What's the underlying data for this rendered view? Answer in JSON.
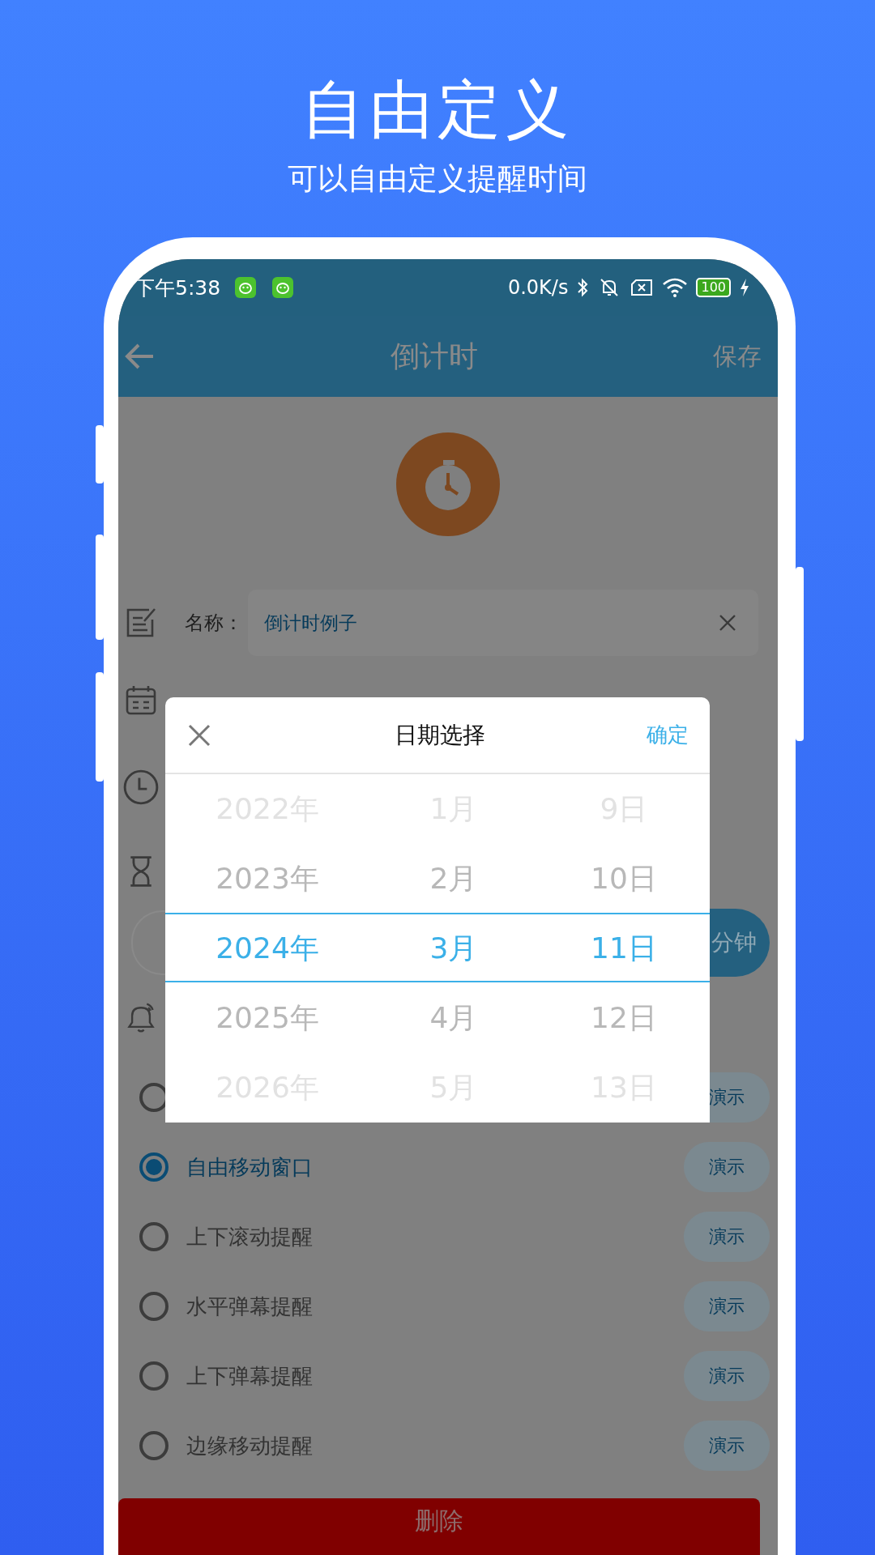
{
  "hero": {
    "title": "自由定义",
    "subtitle": "可以自由定义提醒时间"
  },
  "status_bar": {
    "time": "下午5:38",
    "net_speed": "0.0K/s",
    "battery": "100"
  },
  "header": {
    "title": "倒计时",
    "action": "保存"
  },
  "form": {
    "name_label": "名称：",
    "name_value": "倒计时例子",
    "duration_unit": "分钟"
  },
  "reminder_styles": [
    {
      "demo": "演示",
      "selected": false
    },
    {
      "label": "自由移动窗口",
      "demo": "演示",
      "selected": true
    },
    {
      "label": "上下滚动提醒",
      "demo": "演示",
      "selected": false
    },
    {
      "label": "水平弹幕提醒",
      "demo": "演示",
      "selected": false
    },
    {
      "label": "上下弹幕提醒",
      "demo": "演示",
      "selected": false
    },
    {
      "label": "边缘移动提醒",
      "demo": "演示",
      "selected": false
    }
  ],
  "delete_button": "删除",
  "date_picker": {
    "title": "日期选择",
    "confirm": "确定",
    "columns": [
      {
        "items": [
          {
            "text": "2022年",
            "selected": false
          },
          {
            "text": "2023年",
            "selected": false
          },
          {
            "text": "2024年",
            "selected": true
          },
          {
            "text": "2025年",
            "selected": false
          },
          {
            "text": "2026年",
            "selected": false
          }
        ]
      },
      {
        "items": [
          {
            "text": "1月",
            "selected": false
          },
          {
            "text": "2月",
            "selected": false
          },
          {
            "text": "3月",
            "selected": true
          },
          {
            "text": "4月",
            "selected": false
          },
          {
            "text": "5月",
            "selected": false
          }
        ]
      },
      {
        "items": [
          {
            "text": "9日",
            "selected": false
          },
          {
            "text": "10日",
            "selected": false
          },
          {
            "text": "11日",
            "selected": true
          },
          {
            "text": "12日",
            "selected": false
          },
          {
            "text": "13日",
            "selected": false
          }
        ]
      }
    ]
  }
}
